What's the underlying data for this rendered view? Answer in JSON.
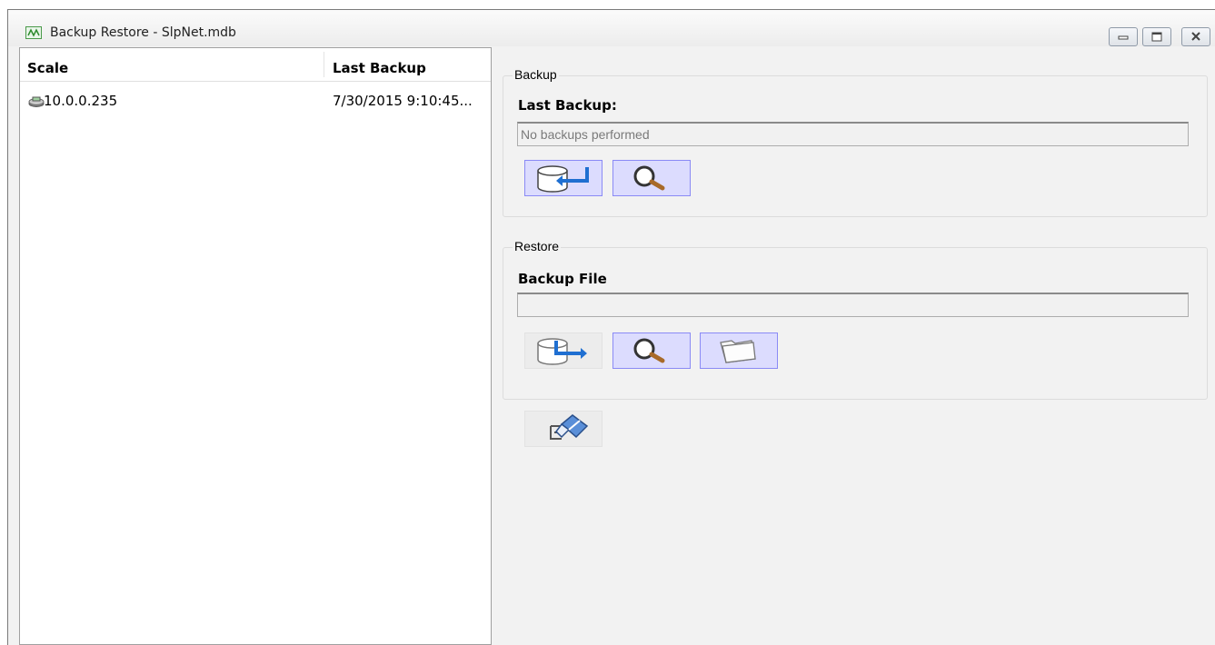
{
  "window": {
    "title": "Backup Restore - SlpNet.mdb",
    "controls": [
      "minimize",
      "maximize",
      "close"
    ]
  },
  "scale_list": {
    "columns": [
      "Scale",
      "Last Backup"
    ],
    "rows": [
      {
        "scale": "10.0.0.235",
        "last_backup": "7/30/2015 9:10:45...",
        "icon": "scale-device-icon"
      }
    ]
  },
  "backup": {
    "group_label": "Backup",
    "field_label": "Last Backup:",
    "field_value": "No backups performed",
    "buttons": [
      {
        "name": "backup-now-button",
        "icon": "database-arrow-icon"
      },
      {
        "name": "browse-backup-button",
        "icon": "magnifier-icon"
      }
    ]
  },
  "restore": {
    "group_label": "Restore",
    "field_label": "Backup File",
    "field_value": "",
    "buttons": [
      {
        "name": "restore-button",
        "icon": "database-restore-icon"
      },
      {
        "name": "search-backup-file-button",
        "icon": "magnifier-icon"
      },
      {
        "name": "open-folder-button",
        "icon": "folder-icon"
      }
    ]
  },
  "extra_button": {
    "name": "clear-button",
    "icon": "eraser-icon"
  }
}
